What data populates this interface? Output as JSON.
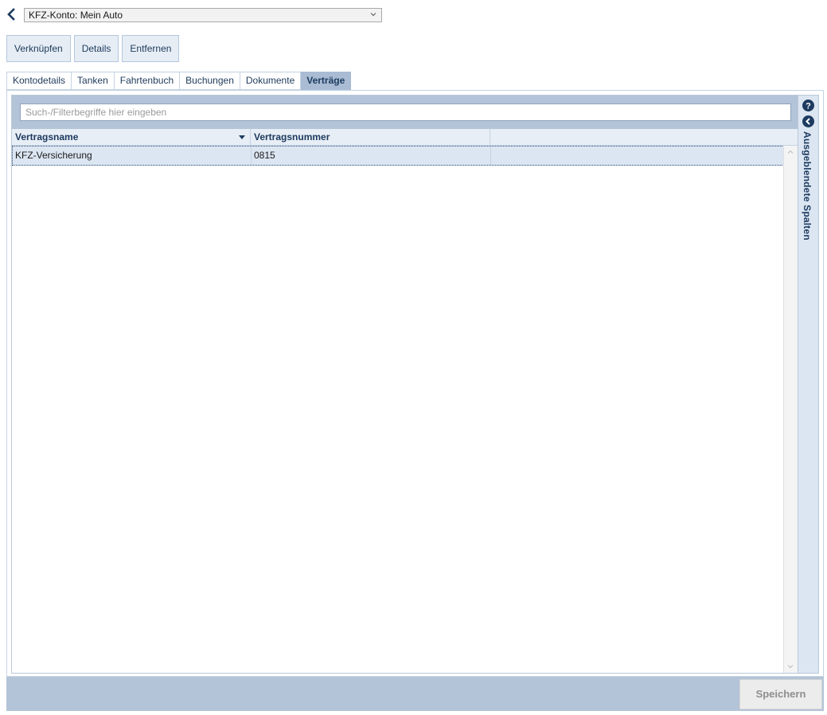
{
  "header": {
    "account_select_value": "KFZ-Konto: Mein Auto"
  },
  "actions": {
    "link_label": "Verknüpfen",
    "details_label": "Details",
    "remove_label": "Entfernen"
  },
  "tabs": [
    {
      "label": "Kontodetails",
      "active": false
    },
    {
      "label": "Tanken",
      "active": false
    },
    {
      "label": "Fahrtenbuch",
      "active": false
    },
    {
      "label": "Buchungen",
      "active": false
    },
    {
      "label": "Dokumente",
      "active": false
    },
    {
      "label": "Verträge",
      "active": true
    }
  ],
  "search": {
    "placeholder": "Such-/Filterbegriffe hier eingeben"
  },
  "table": {
    "columns": [
      "Vertragsname",
      "Vertragsnummer",
      ""
    ],
    "rows": [
      {
        "name": "KFZ-Versicherung",
        "number": "0815",
        "extra": ""
      }
    ]
  },
  "side_panel": {
    "hidden_columns_label": "Ausgeblendete Spalten"
  },
  "footer": {
    "save_label": "Speichern"
  },
  "colors": {
    "accent": "#1d3b60",
    "bar": "#b4c4d8",
    "active_tab": "#a9bcd3"
  }
}
